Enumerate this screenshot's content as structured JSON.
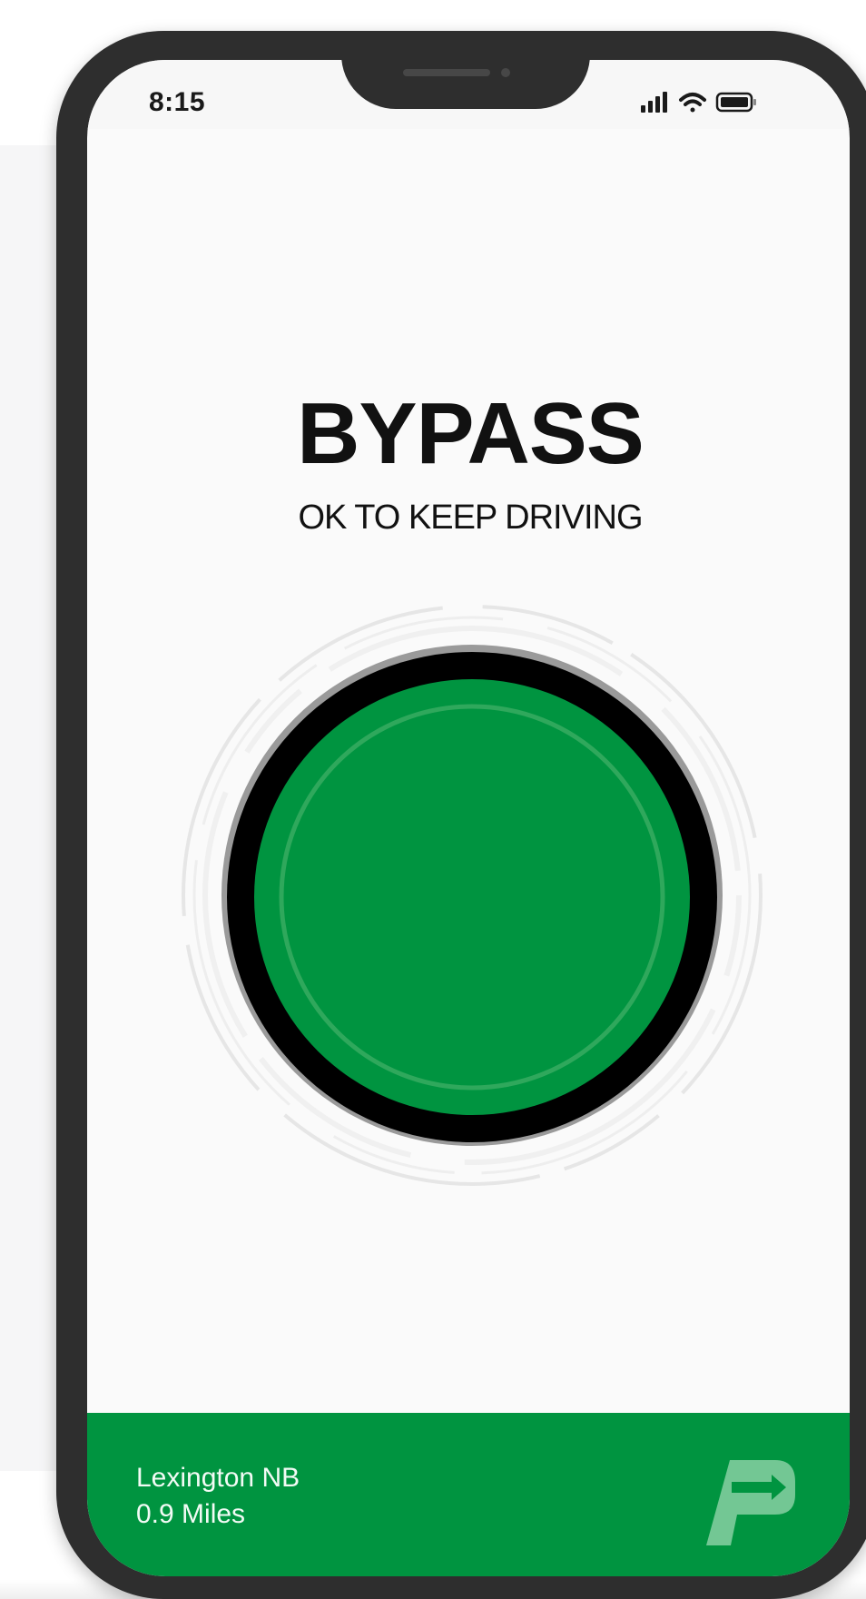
{
  "status_bar": {
    "time": "8:15",
    "icons": [
      "cellular-signal-icon",
      "wifi-icon",
      "battery-icon"
    ]
  },
  "result": {
    "title": "BYPASS",
    "subtitle": "OK TO KEEP DRIVING",
    "indicator_state": "green",
    "indicator_name": "bypass-indicator-icon"
  },
  "footer": {
    "location": "Lexington NB",
    "distance": "0.9 Miles",
    "logo": "prepass-logo"
  },
  "colors": {
    "accent_green": "#009440",
    "indicator_green": "#00923c",
    "ring_black": "#000000",
    "text_dark": "#111111",
    "phone_frame": "#2e2e2e"
  }
}
